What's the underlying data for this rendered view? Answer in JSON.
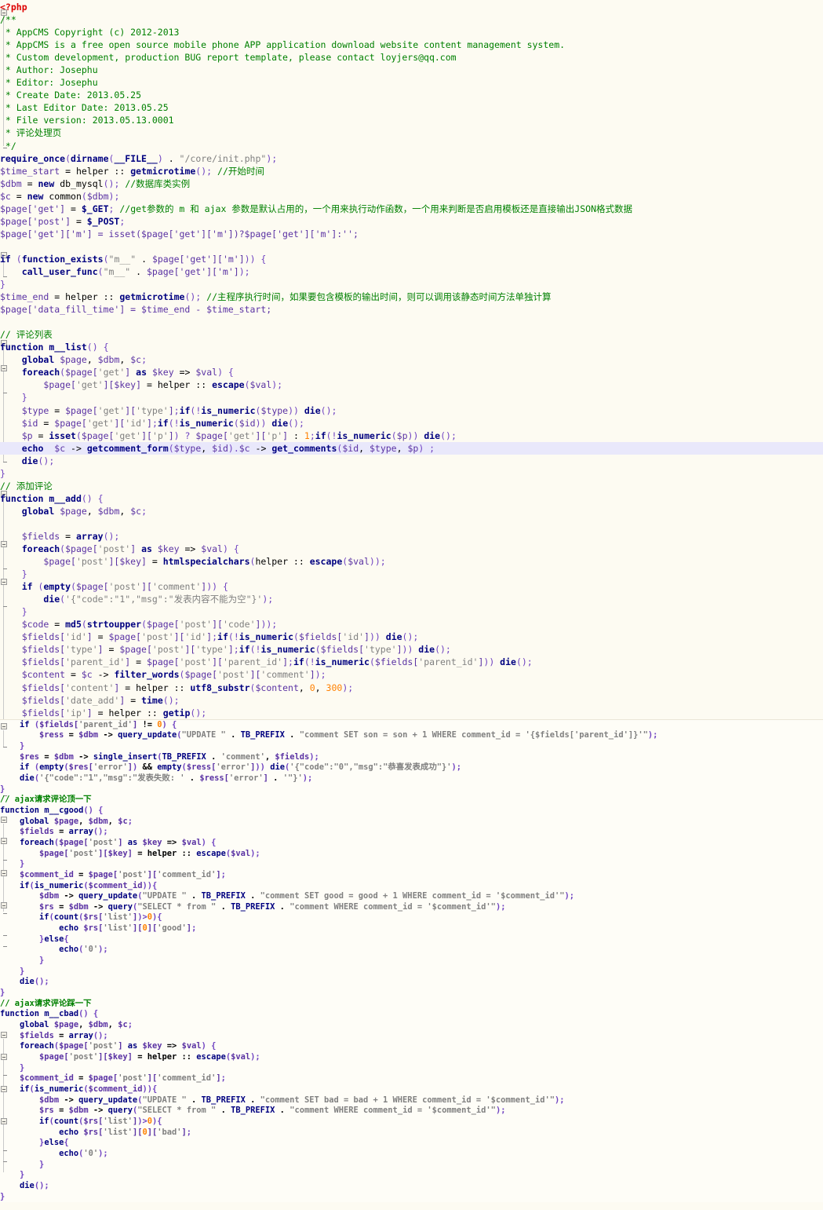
{
  "view": {
    "kind": "source-code-view",
    "language": "PHP",
    "background_color": "#fdfbf2",
    "highlight_line_color": "#e9e8fb",
    "divider_color": "#eae6d8",
    "token_colors": {
      "keyword": "#000080",
      "variable": "#5a32a3",
      "bracket": "#6f42c1",
      "string": "#808080",
      "comment": "#008000",
      "number": "#ff8000",
      "php_tag": "#dd0000",
      "operator": "#000000"
    }
  },
  "code": {
    "header": {
      "php_open_tag": "<?php",
      "doc_open": "/**",
      "doc_lines": [
        " * AppCMS Copyright (c) 2012-2013",
        " * AppCMS is a free open source mobile phone APP application download website content management system.",
        " * Custom development, production BUG report template, please contact loyjers@qq.com",
        " * Author: Josephu",
        " * Editor: Josephu",
        " * Create Date: 2013.05.25",
        " * Last Editor Date: 2013.05.25",
        " * File version: 2013.05.13.0001",
        " * 评论处理页"
      ],
      "doc_close": " */"
    },
    "bootstrap": {
      "require_keyword": "require_once",
      "require_args_open": "(",
      "dirname": "dirname",
      "file_const": "__FILE__",
      "concat": " . ",
      "init_path": "\"/core/init.php\"",
      "require_end": ");",
      "time_start_var": "$time_start",
      "helper": "helper",
      "scope": " :: ",
      "getmicrotime": "getmicrotime",
      "comment_start_time": "//开始时间",
      "dbm_var": "$dbm",
      "new_kw": "new",
      "db_mysql": "db_mysql",
      "comment_db": "//数据库类实例",
      "c_var": "$c",
      "common_cls": "common",
      "page_get": "$page['get']",
      "get_super": "$_GET",
      "comment_get": "//get参数的 m 和 ajax 参数是默认占用的，一个用来执行动作函数，一个用来判断是否启用模板还是直接输出JSON格式数据",
      "page_post": "$page['post']",
      "post_super": "$_POST",
      "page_get_m_assign": "$page['get']['m'] = isset($page['get']['m'])?$page['get']['m']:'';",
      "if_kw": "if",
      "function_exists": "function_exists",
      "m_prefix": "\"m__\"",
      "call_user_func": "call_user_func",
      "time_end_var": "$time_end",
      "comment_end_time": "//主程序执行时间，如果要包含模板的输出时间，则可以调用该静态时间方法单独计算",
      "data_fill_time": "$page['data_fill_time'] = $time_end - $time_start;"
    },
    "sections": [
      {
        "comment": "// 评论列表",
        "function_name": "m__list",
        "highlight_line_index": 8
      },
      {
        "comment": "// 添加评论",
        "function_name": "m__add"
      },
      {
        "comment": "// ajax请求评论顶一下",
        "function_name": "m__cgood"
      },
      {
        "comment": "// ajax请求评论踩一下",
        "function_name": "m__cbad"
      }
    ],
    "strings": {
      "msg_empty": "'{\"code\":\"1\",\"msg\":\"发表内容不能为空\"}'",
      "msg_success": "'{\"code\":\"0\",\"msg\":\"恭喜发表成功\"}'",
      "msg_fail": "'{\"code\":\"1\",\"msg\":\"发表失败: '",
      "msg_fail_tail": "'\"}'",
      "sql_update_son": "\"UPDATE \"",
      "tb_prefix": "TB_PREFIX",
      "sql_son_body": "\"comment SET son = son + 1 WHERE comment_id = '{$fields['parent_id']}'\"",
      "sql_good_body": "\"comment SET good = good + 1 WHERE comment_id = '$comment_id'\"",
      "sql_bad_body": "\"comment SET bad = bad + 1 WHERE comment_id = '$comment_id'\"",
      "sql_select": "\"SELECT * from \"",
      "sql_where": "\"comment WHERE comment_id = '$comment_id'\"",
      "comment_tbl": "'comment'"
    }
  }
}
